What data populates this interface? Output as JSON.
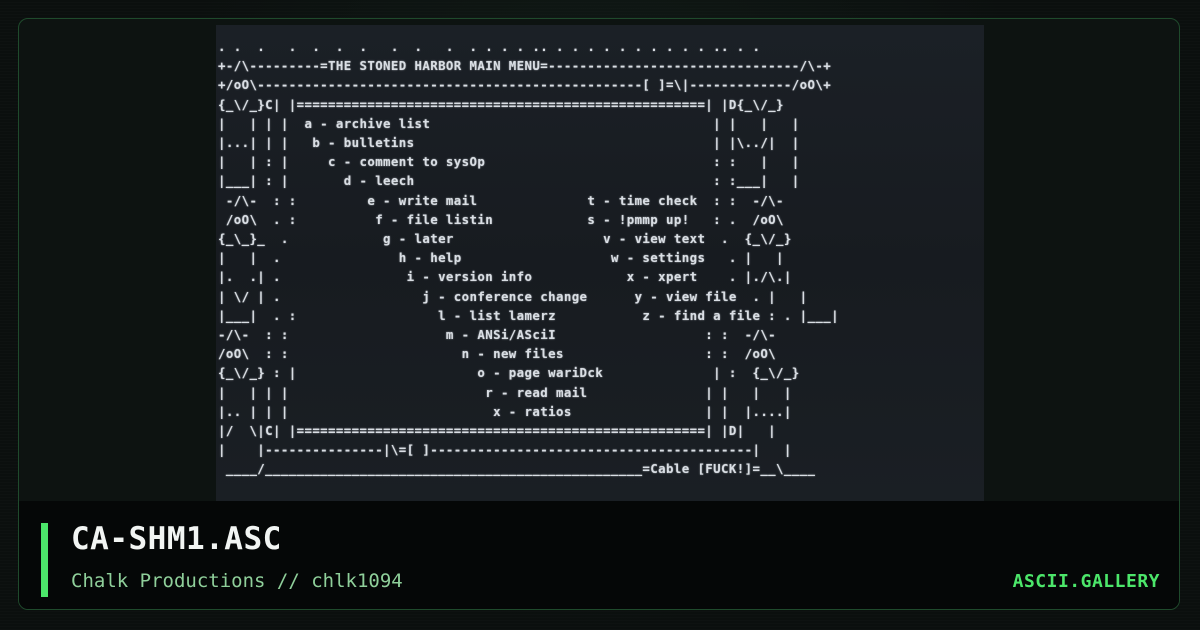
{
  "artwork": {
    "ascii": ". .  .   .  .  .  .   .  .   .  . . . . .. . . . . . . . . . . .. . .\n+-/\\---------=THE STONED HARBOR MAIN MENU=--------------------------------/\\-+\n+/oO\\-------------------------------------------------[ ]=\\|-------------/oO\\+\n{_\\/_}C| |====================================================| |D{_\\/_}\n|   | | |  a - archive list                                    | |   |   |\n|...| | |   b - bulletins                                      | |\\../|  |\n|   | : |     c - comment to sysOp                             : :   |   |\n|___| : |       d - leech                                      : :___|   |\n -/\\-  : :         e - write mail              t - time check  : :  -/\\-\n /oO\\  . :          f - file listin            s - !pmmp up!   : .  /oO\\\n{_\\_}_  .            g - later                   v - view text  .  {_\\/_}\n|   |  .               h - help                   w - settings   . |   |\n|.  .| .                i - version info            x - xpert    . |./\\.|\n| \\/ | .                  j - conference change      y - view file  . |   |\n|___|  . :                  l - list lamerz           z - find a file : . |___|\n-/\\-  : :                    m - ANSi/ASciI                   : :  -/\\-\n/oO\\  : :                      n - new files                  : :  /oO\\\n{_\\/_} : |                       o - page wariDck              | :  {_\\/_}\n|   | | |                         r - read mail               | |   |   |\n|.. | | |                          x - ratios                 | |  |....|\n|/  \\|C| |====================================================| |D|   |\n|    |---------------|\\=[ ]-----------------------------------------|   |\n ____/________________________________________________=Cable [FUCK!]=__\\____"
  },
  "footer": {
    "title": "CA-SHM1.ASC",
    "subtitle": "Chalk Productions // chlk1094",
    "brand": "ASCII.GALLERY"
  },
  "colors": {
    "accent": "#4ce66a",
    "border": "#1f4a2c",
    "background": "#0b0f0e",
    "subtitle": "#8fcf9a"
  }
}
